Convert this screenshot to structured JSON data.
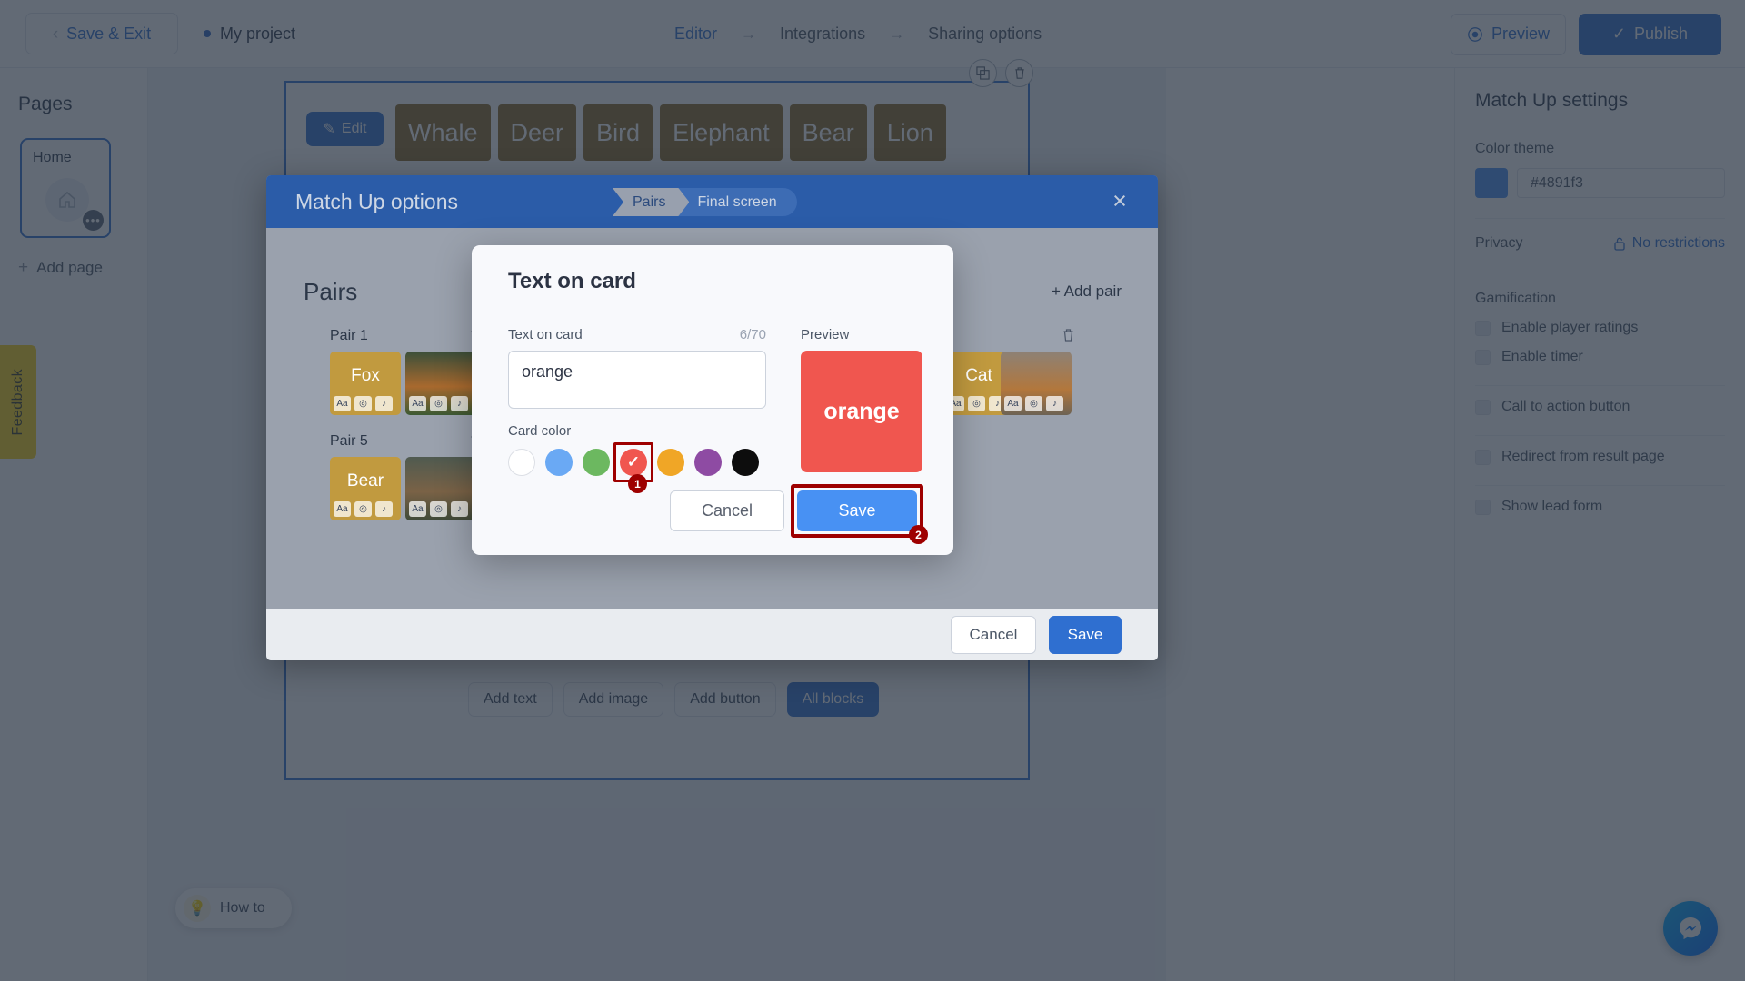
{
  "topbar": {
    "save_exit": "Save & Exit",
    "project_name": "My project",
    "steps": [
      {
        "label": "Editor",
        "active": true
      },
      {
        "label": "Integrations",
        "active": false
      },
      {
        "label": "Sharing options",
        "active": false
      }
    ],
    "arrow": "→",
    "preview": "Preview",
    "publish": "Publish",
    "publish_check": "✓",
    "chevron_left": "‹"
  },
  "pages_panel": {
    "title": "Pages",
    "page_name": "Home",
    "dots": "•••",
    "add_page": "Add page",
    "plus": "+"
  },
  "canvas": {
    "edit_button": "Edit",
    "pencil": "✎",
    "words": [
      "Whale",
      "Deer",
      "Bird",
      "Elephant",
      "Bear",
      "Lion"
    ],
    "copy_icon": "⧉",
    "trash_icon": "Ὕ1",
    "bottom_buttons": [
      "Add text",
      "Add image",
      "Add button",
      "All blocks"
    ],
    "how_to": "How to",
    "bulb": "💡",
    "feedback": "Feedback"
  },
  "settings": {
    "title": "Match Up settings",
    "color_theme_label": "Color theme",
    "color_theme_value": "#4891f3",
    "color_theme_hex": "#4891f3",
    "privacy_label": "Privacy",
    "privacy_value": "No restrictions",
    "lock_icon": "🔓",
    "gamification_label": "Gamification",
    "options": [
      "Enable player ratings",
      "Enable timer",
      "Call to action button",
      "Redirect from result page",
      "Show lead form"
    ]
  },
  "match_up_modal": {
    "title": "Match Up options",
    "chips": [
      {
        "label": "Pairs",
        "active": true
      },
      {
        "label": "Final screen",
        "active": false
      }
    ],
    "close": "×",
    "pairs_title": "Pairs",
    "add_pair": "+ Add pair",
    "pair_labels": [
      "Pair 1",
      "Pair 5"
    ],
    "trash": "🗑",
    "cards": {
      "pair1_word": "Fox",
      "pair1_word_right": "Cat",
      "pair5_word": "Bear"
    },
    "mini_icons": [
      "Aa",
      "◎",
      "♪"
    ],
    "footer_cancel": "Cancel",
    "footer_save": "Save"
  },
  "text_on_card_dialog": {
    "heading": "Text on card",
    "field_label": "Text on card",
    "counter": "6/70",
    "input_value": "orange",
    "card_color_label": "Card color",
    "colors": [
      {
        "name": "white",
        "hex": "#ffffff",
        "selected": false
      },
      {
        "name": "blue",
        "hex": "#6aa9f4",
        "selected": false
      },
      {
        "name": "green",
        "hex": "#6cb860",
        "selected": false
      },
      {
        "name": "red",
        "hex": "#f0564f",
        "selected": true
      },
      {
        "name": "orange",
        "hex": "#f0a626",
        "selected": false
      },
      {
        "name": "purple",
        "hex": "#8e4ba3",
        "selected": false
      },
      {
        "name": "black",
        "hex": "#0d0d0d",
        "selected": false
      }
    ],
    "check_mark": "✓",
    "badge_1": "1",
    "badge_2": "2",
    "preview_label": "Preview",
    "preview_text": "orange",
    "preview_color": "#f0564f",
    "cancel": "Cancel",
    "save": "Save"
  }
}
